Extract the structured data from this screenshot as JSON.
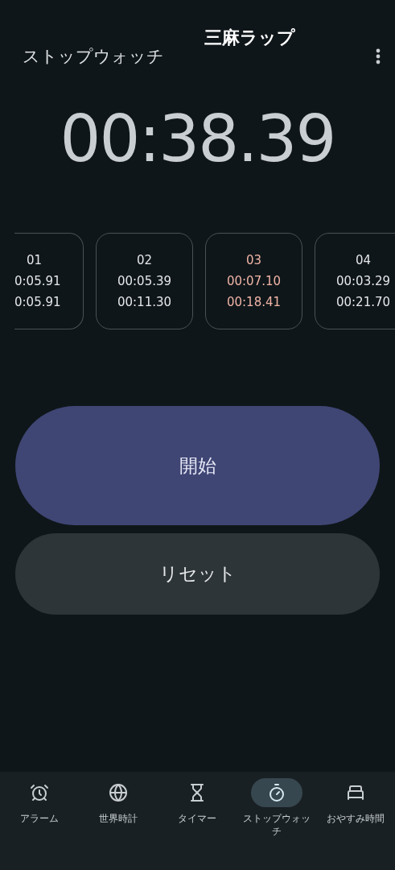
{
  "header": {
    "title": "ストップウォッチ",
    "lap_title": "三麻ラップ"
  },
  "time": "00:38.39",
  "laps": [
    {
      "kind": "cut_left",
      "number": "01",
      "lap": "0:05.91",
      "total": "0:05.91",
      "highlighted": false
    },
    {
      "kind": "full",
      "number": "02",
      "lap": "00:05.39",
      "total": "00:11.30",
      "highlighted": false
    },
    {
      "kind": "full",
      "number": "03",
      "lap": "00:07.10",
      "total": "00:18.41",
      "highlighted": true
    },
    {
      "kind": "cut_right",
      "number": "04",
      "lap": "00:03.29",
      "total": "00:21.70",
      "highlighted": false
    }
  ],
  "buttons": {
    "start": "開始",
    "reset": "リセット"
  },
  "nav": [
    {
      "kind": "alarm",
      "label": "アラーム",
      "selected": false
    },
    {
      "kind": "world",
      "label": "世界時計",
      "selected": false
    },
    {
      "kind": "timer",
      "label": "タイマー",
      "selected": false
    },
    {
      "kind": "stopwatch",
      "label": "ストップウォッチ",
      "selected": true
    },
    {
      "kind": "bedtime",
      "label": "おやすみ時間",
      "selected": false
    }
  ]
}
